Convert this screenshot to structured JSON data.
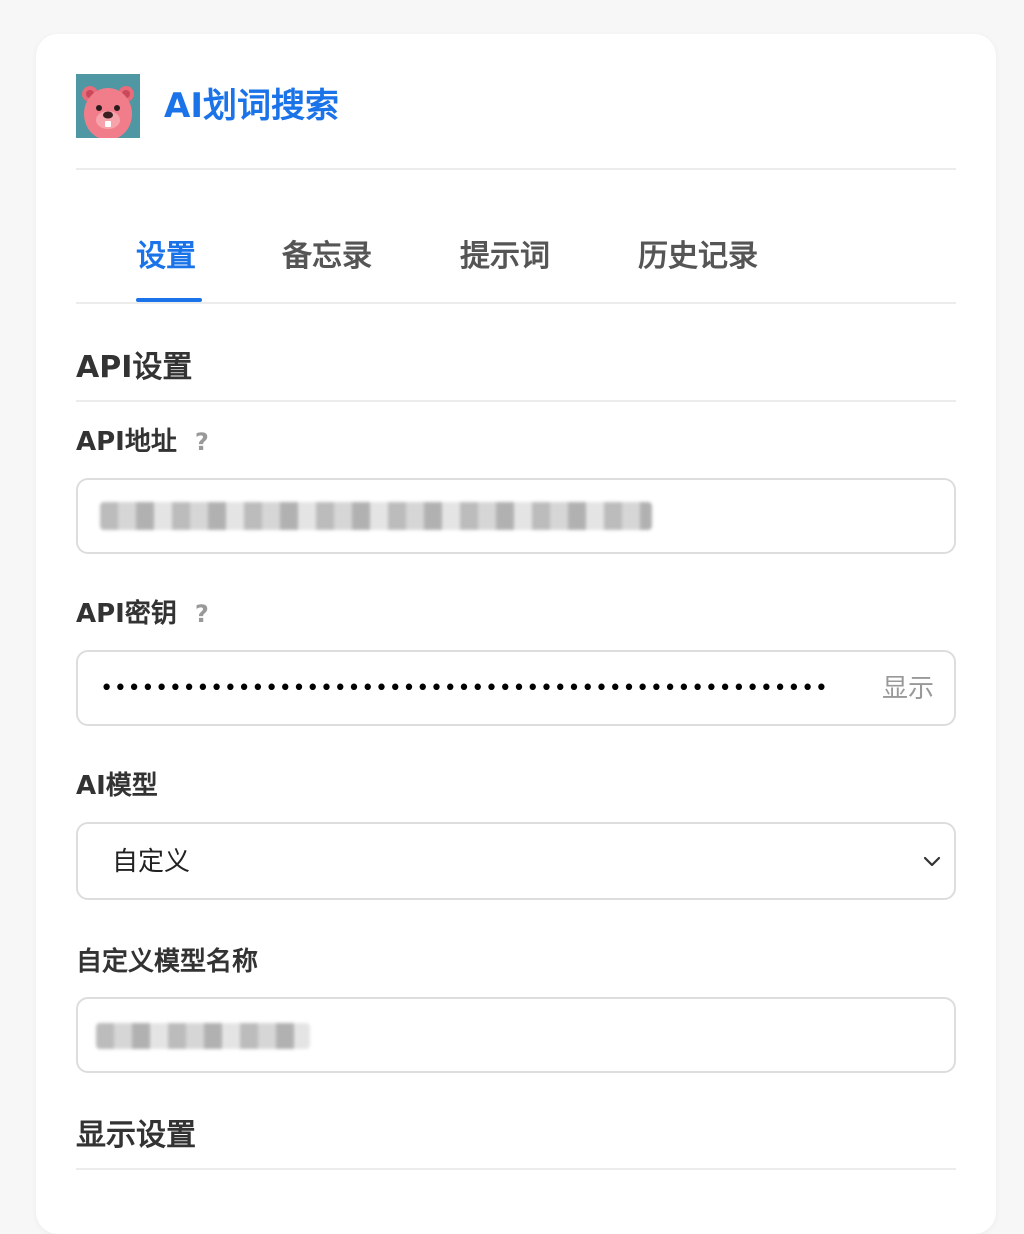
{
  "header": {
    "app_title": "AI划词搜索"
  },
  "tabs": [
    {
      "label": "设置",
      "active": true
    },
    {
      "label": "备忘录",
      "active": false
    },
    {
      "label": "提示词",
      "active": false
    },
    {
      "label": "历史记录",
      "active": false
    }
  ],
  "api_section": {
    "title": "API设置",
    "url_field": {
      "label": "API地址",
      "help": "?",
      "value_redacted": true
    },
    "key_field": {
      "label": "API密钥",
      "help": "?",
      "masked_value": "•••••••••••••••••••••••••••••••••••••••••••••••••••••",
      "show_label": "显示"
    },
    "model_field": {
      "label": "AI模型",
      "selected": "自定义"
    },
    "custom_model_field": {
      "label": "自定义模型名称",
      "value_redacted": true
    }
  },
  "display_section": {
    "title": "显示设置"
  },
  "colors": {
    "accent": "#1a73e8",
    "text": "#333333",
    "muted": "#999999",
    "border": "#dddddd",
    "background": "#f7f7f7"
  }
}
